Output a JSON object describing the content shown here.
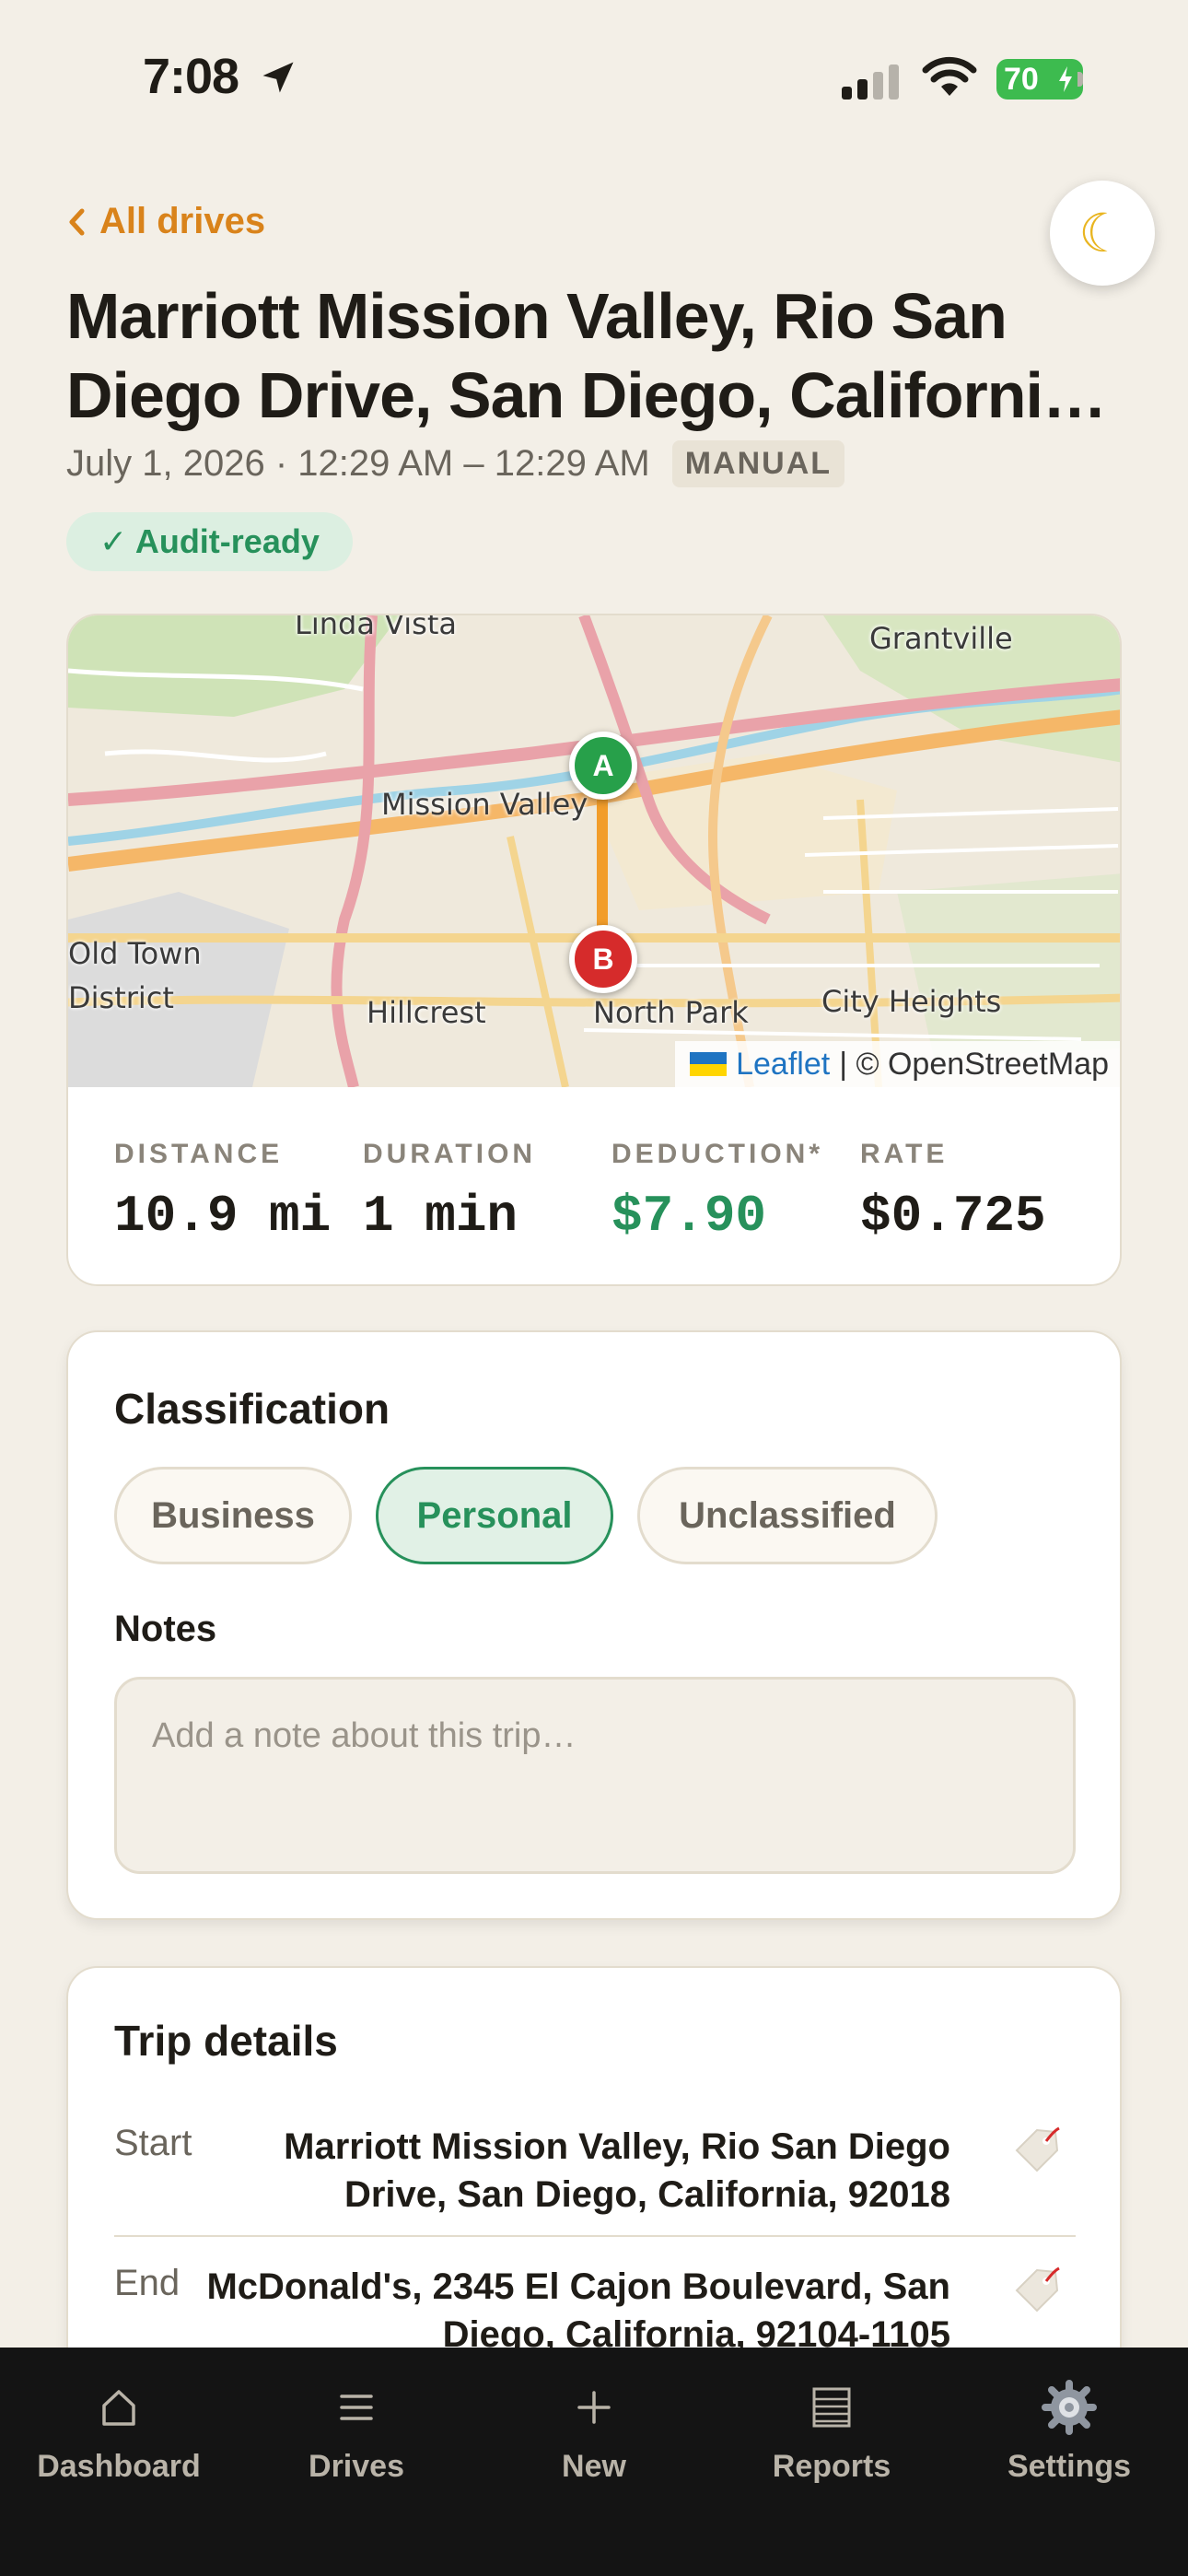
{
  "status_bar": {
    "time": "7:08",
    "battery": "70",
    "icons": [
      "location-arrow-icon",
      "cellular-signal-icon",
      "wifi-icon",
      "battery-charging-icon"
    ]
  },
  "header": {
    "back_label": "All drives",
    "title": "Marriott Mission Valley, Rio San Diego Drive, San Diego, California, 92018",
    "date": "July 1, 2026 · 12:29 AM – 12:29 AM",
    "source_badge": "MANUAL",
    "audit_status": "✓ Audit-ready",
    "theme_icon": "moon-icon"
  },
  "map": {
    "labels": {
      "linda_vista": "Linda Vista",
      "grantville": "Grantville",
      "mission_valley": "Mission Valley",
      "old_town": "Old Town",
      "district": "District",
      "hillcrest": "Hillcrest",
      "north_park": "North Park",
      "city_heights": "City Heights"
    },
    "start_marker": "A",
    "end_marker": "B",
    "attribution_leaflet": "Leaflet",
    "attribution_osm": "| © OpenStreetMap",
    "colors": {
      "start": "#27a04a",
      "end": "#d62b2b",
      "route": "#f29d2a"
    }
  },
  "stats": [
    {
      "label": "DISTANCE",
      "value": "10.9 mi"
    },
    {
      "label": "DURATION",
      "value": "1 min"
    },
    {
      "label": "DEDUCTION*",
      "value": "$7.90"
    },
    {
      "label": "RATE",
      "value": "$0.725"
    }
  ],
  "classification": {
    "title": "Classification",
    "options": [
      "Business",
      "Personal",
      "Unclassified"
    ],
    "selected": "Personal",
    "notes_label": "Notes",
    "notes_placeholder": "Add a note about this trip…",
    "notes_value": ""
  },
  "trip_details": {
    "title": "Trip details",
    "rows": [
      {
        "key": "Start",
        "value": "Marriott Mission Valley, Rio San Diego Drive, San Diego, California, 92018"
      },
      {
        "key": "End",
        "value": "McDonald's, 2345 El Cajon Boulevard, San Diego, California, 92104-1105"
      }
    ]
  },
  "tab_bar": {
    "tabs": [
      {
        "label": "Dashboard",
        "icon": "home-icon"
      },
      {
        "label": "Drives",
        "icon": "list-icon"
      },
      {
        "label": "New",
        "icon": "plus-icon"
      },
      {
        "label": "Reports",
        "icon": "reports-icon"
      },
      {
        "label": "Settings",
        "icon": "gear-icon"
      }
    ]
  },
  "accent_colors": {
    "orange": "#d9831b",
    "green": "#27915b",
    "background": "#f3efe7"
  }
}
